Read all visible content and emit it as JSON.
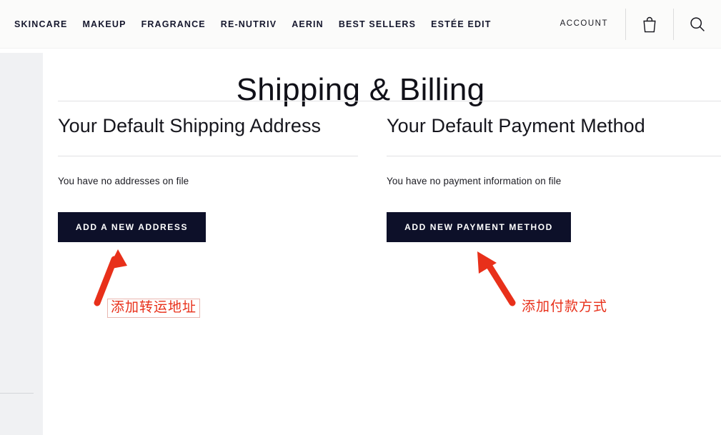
{
  "header": {
    "nav_items": [
      {
        "label": "SKINCARE",
        "name": "nav-item-skincare"
      },
      {
        "label": "MAKEUP",
        "name": "nav-item-makeup"
      },
      {
        "label": "FRAGRANCE",
        "name": "nav-item-fragrance"
      },
      {
        "label": "RE-NUTRIV",
        "name": "nav-item-re-nutriv"
      },
      {
        "label": "AERIN",
        "name": "nav-item-aerin"
      },
      {
        "label": "BEST SELLERS",
        "name": "nav-item-best-sellers"
      },
      {
        "label": "ESTÉE EDIT",
        "name": "nav-item-estee-edit"
      }
    ],
    "account_label": "ACCOUNT",
    "bag_icon": "shopping-bag-icon",
    "search_icon": "search-icon"
  },
  "page": {
    "title": "Shipping & Billing"
  },
  "shipping": {
    "heading": "Your Default Shipping Address",
    "empty_text": "You have no addresses on file",
    "button_label": "ADD A NEW ADDRESS"
  },
  "payment": {
    "heading": "Your Default Payment Method",
    "empty_text": "You have no payment information on file",
    "button_label": "ADD NEW PAYMENT METHOD"
  },
  "annotations": {
    "color": "#e8301a",
    "shipping_note": "添加转运地址",
    "payment_note": "添加付款方式"
  },
  "colors": {
    "button_bg": "#0d1029",
    "nav_text": "#16182e",
    "rail_bg": "#f0f1f3",
    "header_bg": "#fbfbfa"
  }
}
